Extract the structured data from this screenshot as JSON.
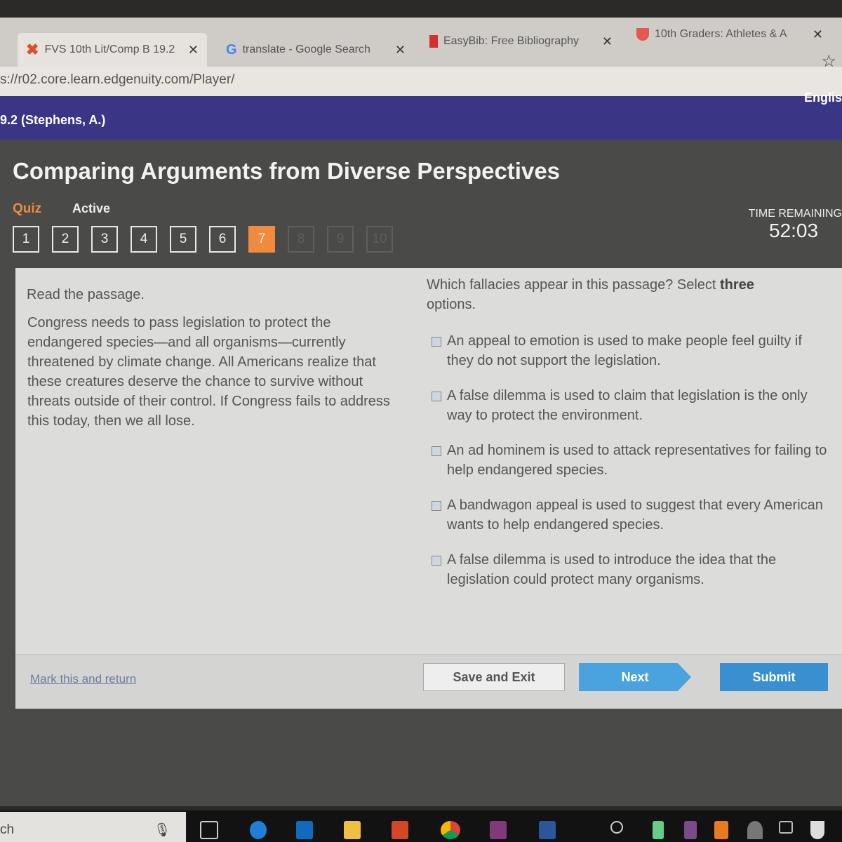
{
  "browser": {
    "tabs": [
      {
        "title": "FVS 10th Lit/Comp B 19.2 (",
        "icon": "edgenuity-x-icon",
        "active": true
      },
      {
        "title": "translate - Google Search",
        "icon": "google-g-icon"
      },
      {
        "title": "EasyBib: Free Bibliography",
        "icon": "easybib-icon"
      },
      {
        "title": "10th Graders: Athletes & A",
        "icon": "shield-icon"
      }
    ],
    "close_glyph": "✕",
    "url": "s://r02.core.learn.edgenuity.com/Player/"
  },
  "header": {
    "course": "9.2 (Stephens, A.)",
    "language": "Englis"
  },
  "activity": {
    "title": "Comparing Arguments from Diverse Perspectives",
    "type": "Quiz",
    "status": "Active",
    "questions": [
      "1",
      "2",
      "3",
      "4",
      "5",
      "6",
      "7",
      "8",
      "9",
      "10"
    ],
    "current_question": 7,
    "time_label": "TIME REMAINING",
    "time": "52:03"
  },
  "passage": {
    "instruction": "Read the passage.",
    "text": "Congress needs to pass legislation to protect the endangered species—and all organisms—currently threatened by climate change. All Americans realize that these creatures deserve the chance to survive without threats outside of their control. If Congress fails to address this today, then we all lose."
  },
  "question": {
    "prompt_start": "Which fallacies appear in this passage? Select ",
    "prompt_bold": "three",
    "prompt_end": " options.",
    "options": [
      "An appeal to emotion is used to make people feel guilty if they do not support the legislation.",
      "A false dilemma is used to claim that legislation is the only way to protect the environment.",
      "An ad hominem is used to attack representatives for failing to help endangered species.",
      "A bandwagon appeal is used to suggest that every American wants to help endangered species.",
      "A false dilemma is used to introduce the idea that the legislation could protect many organisms."
    ]
  },
  "footer": {
    "mark": "Mark this and return",
    "save": "Save and Exit",
    "next": "Next",
    "submit": "Submit"
  },
  "taskbar": {
    "search": "ch"
  },
  "colors": {
    "accent": "#f08a3c",
    "purple": "#3a3585",
    "next": "#4aa3df",
    "submit": "#3a8fd0"
  }
}
